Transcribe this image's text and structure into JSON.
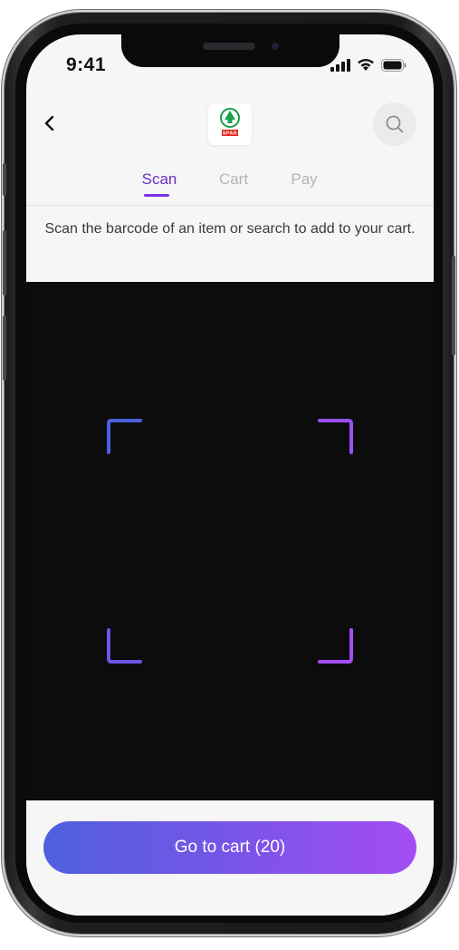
{
  "status_bar": {
    "time": "9:41"
  },
  "header": {
    "back_icon": "chevron-left-icon",
    "logo_text": "SPAR",
    "search_icon": "search-icon"
  },
  "tabs": [
    {
      "label": "Scan",
      "active": true
    },
    {
      "label": "Cart",
      "active": false
    },
    {
      "label": "Pay",
      "active": false
    }
  ],
  "instruction": "Scan the barcode of an item or search to add to your cart.",
  "viewfinder": {
    "frame_colors": [
      "#4a62dc",
      "#9a50f2",
      "#6e55e6",
      "#a24df4"
    ]
  },
  "cart_button": {
    "label": "Go to cart (20)"
  },
  "colors": {
    "accent": "#7b2ff0",
    "tab_active": "#6a2fbd",
    "tab_inactive": "#b4b4b8",
    "spar_green": "#17a04a",
    "spar_red": "#e2231a"
  }
}
